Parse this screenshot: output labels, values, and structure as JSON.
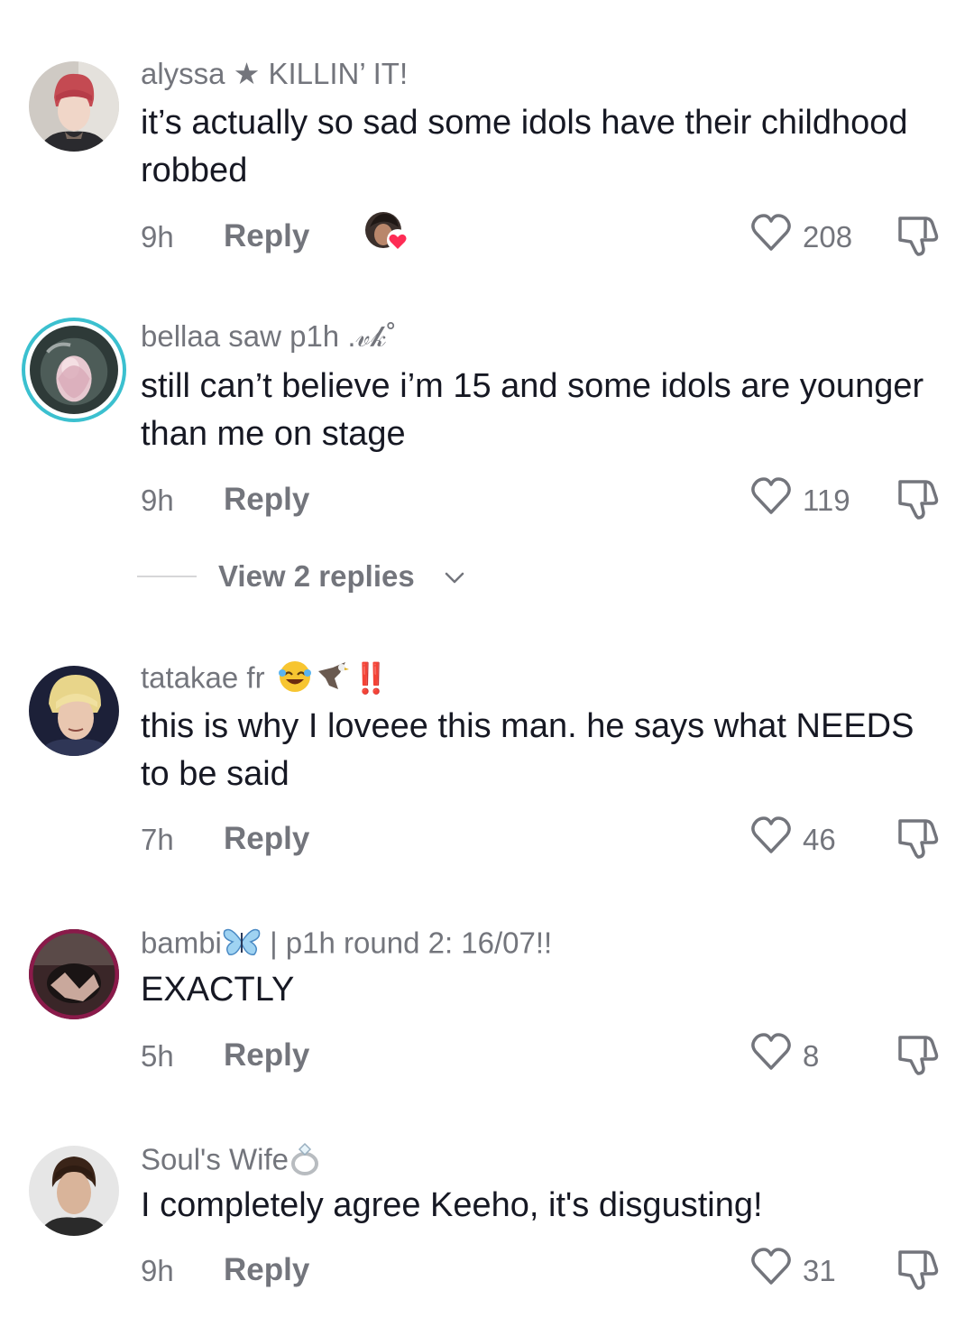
{
  "comments": [
    {
      "username": "alyssa ★ KILLIN’ IT!",
      "text": "it’s actually so sad some idols have their childhood robbed",
      "time": "9h",
      "reply_label": "Reply",
      "likes": "208",
      "creator_liked": true
    },
    {
      "username": "bellaa saw p1h .𝓋𝓀˚",
      "text": "still can’t believe i’m 15 and some idols are younger than me on stage",
      "time": "9h",
      "reply_label": "Reply",
      "likes": "119",
      "has_story_ring": true
    },
    {
      "username": "tatakae fr",
      "username_suffix": "‼️",
      "text": "this is why I loveee this man. he says what NEEDS to be said",
      "time": "7h",
      "reply_label": "Reply",
      "likes": "46"
    },
    {
      "username": "bambi",
      "username_suffix": "| p1h round 2: 16/07!!",
      "text": "EXACTLY",
      "time": "5h",
      "reply_label": "Reply",
      "likes": "8"
    },
    {
      "username": "Soul's Wife",
      "text": "I completely agree Keeho, it's disgusting!",
      "time": "9h",
      "reply_label": "Reply",
      "likes": "31"
    }
  ],
  "view_replies": {
    "label": "View 2 replies"
  },
  "icons": {
    "like": "heart-outline-icon",
    "dislike": "thumbs-down-icon",
    "chevron": "chevron-down-icon"
  },
  "colors": {
    "text": "#161823",
    "secondary": "#73757c",
    "story_ring": "#3bc0cf",
    "creator_heart": "#fe2c55"
  }
}
